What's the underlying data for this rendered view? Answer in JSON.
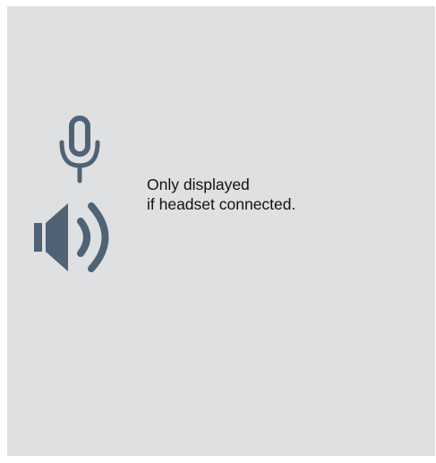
{
  "caption": {
    "line1": "Only displayed",
    "line2": "if headset connected."
  },
  "icons": {
    "microphone": "microphone-icon",
    "speaker": "speaker-icon"
  },
  "colors": {
    "background": "#dfe0e2",
    "icon": "#4f6375",
    "text": "#111111"
  }
}
